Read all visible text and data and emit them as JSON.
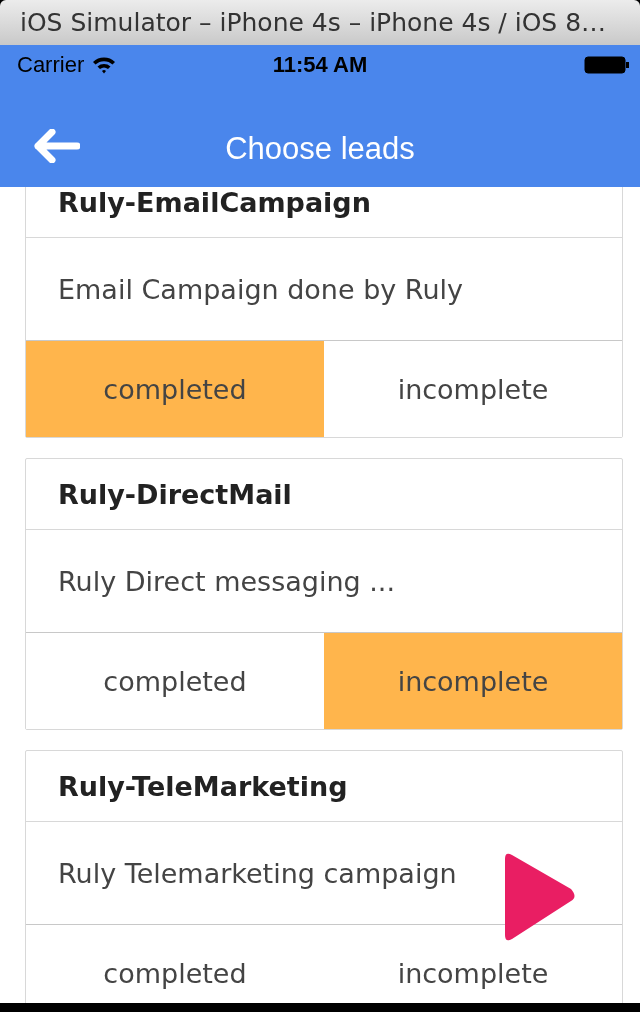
{
  "window": {
    "title": "iOS Simulator – iPhone 4s – iPhone 4s / iOS 8…"
  },
  "status_bar": {
    "carrier": "Carrier",
    "time": "11:54 AM"
  },
  "nav": {
    "title": "Choose leads"
  },
  "leads": [
    {
      "name": "Ruly-EmailCampaign",
      "description": "Email Campaign done by Ruly",
      "options": [
        {
          "label": "completed",
          "selected": true
        },
        {
          "label": "incomplete",
          "selected": false
        }
      ]
    },
    {
      "name": "Ruly-DirectMail",
      "description": "Ruly Direct messaging ...",
      "options": [
        {
          "label": "completed",
          "selected": false
        },
        {
          "label": "incomplete",
          "selected": true
        }
      ]
    },
    {
      "name": "Ruly-TeleMarketing",
      "description": "Ruly Telemarketing campaign",
      "options": [
        {
          "label": "completed",
          "selected": false
        },
        {
          "label": "incomplete",
          "selected": false
        }
      ]
    }
  ]
}
